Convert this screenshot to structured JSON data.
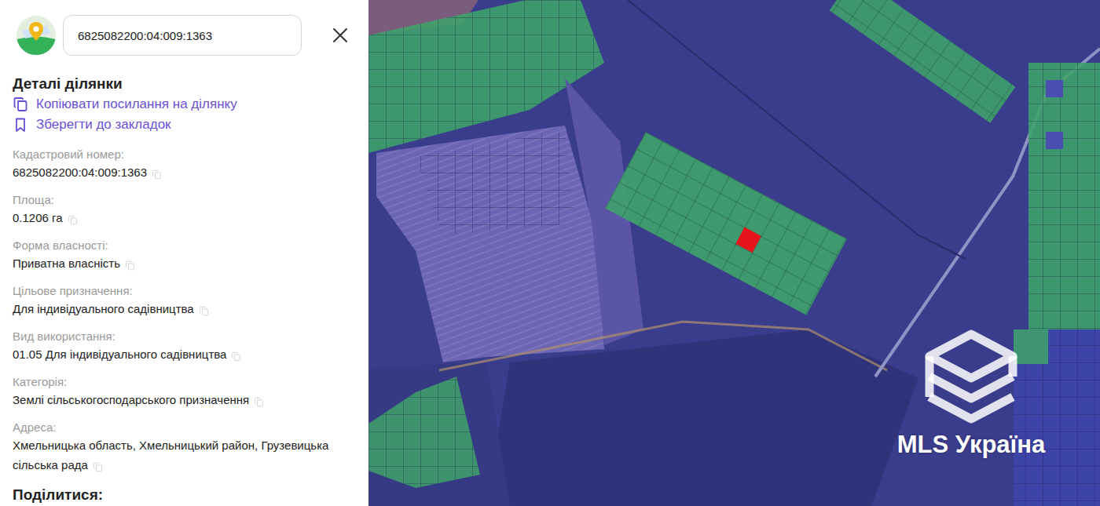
{
  "search": {
    "value": "6825082200:04:009:1363"
  },
  "details": {
    "title": "Деталі ділянки",
    "actions": [
      {
        "label": "Копіювати посилання на ділянку",
        "kind": "copy"
      },
      {
        "label": "Зберегти до закладок",
        "kind": "bookmark"
      }
    ]
  },
  "fields": [
    {
      "label": "Кадастровий номер:",
      "value": "6825082200:04:009:1363"
    },
    {
      "label": "Площа:",
      "value": "0.1206 га"
    },
    {
      "label": "Форма власності:",
      "value": "Приватна власність"
    },
    {
      "label": "Цільове призначення:",
      "value": "Для індивідуального садівництва"
    },
    {
      "label": "Вид використання:",
      "value": "01.05 Для індивідуального садівництва"
    },
    {
      "label": "Категорія:",
      "value": "Землі сільськогосподарського призначення"
    },
    {
      "label": "Адреса:",
      "value": "Хмельницька область, Хмельницький район, Грузевицька сільська рада"
    }
  ],
  "share": {
    "title": "Поділитися:"
  },
  "map": {
    "watermark": "MLS Україна",
    "parcel": {
      "selected": true
    }
  }
}
